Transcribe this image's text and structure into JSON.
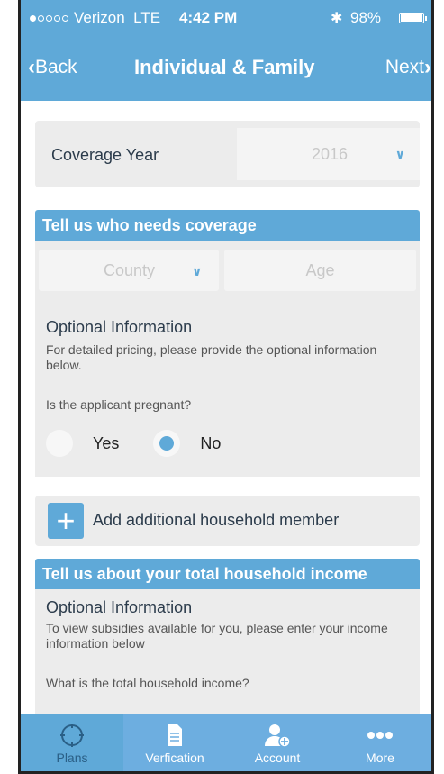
{
  "status_bar": {
    "signal": "●○○○○",
    "carrier": "Verizon",
    "network": "LTE",
    "time": "4:42 PM",
    "bluetooth": "✱",
    "battery": "98%"
  },
  "nav": {
    "back_label": "Back",
    "title": "Individual & Family",
    "next_label": "Next"
  },
  "coverage": {
    "label": "Coverage Year",
    "value": "2016"
  },
  "who_section": {
    "title": "Tell us who needs coverage",
    "county_placeholder": "County",
    "age_placeholder": "Age",
    "optional_title": "Optional Information",
    "optional_desc": "For detailed pricing, please provide the optional information below.",
    "pregnant_question": "Is the applicant pregnant?",
    "yes_label": "Yes",
    "no_label": "No",
    "selected": "No"
  },
  "add_member": {
    "label": "Add additional household member"
  },
  "income_section": {
    "title": "Tell us about your total household income",
    "optional_title": "Optional Information",
    "optional_desc": "To view subsidies available for you, please enter your income information below",
    "question": "What is the total household income?"
  },
  "tab_bar": {
    "active": "Plans",
    "tabs": [
      {
        "label": "Plans",
        "icon": "compass-icon"
      },
      {
        "label": "Verfication",
        "icon": "document-icon"
      },
      {
        "label": "Account",
        "icon": "add-user-icon"
      },
      {
        "label": "More",
        "icon": "more-dots-icon"
      }
    ]
  },
  "colors": {
    "accent": "#5fa9d8",
    "card_bg": "#ececec"
  }
}
